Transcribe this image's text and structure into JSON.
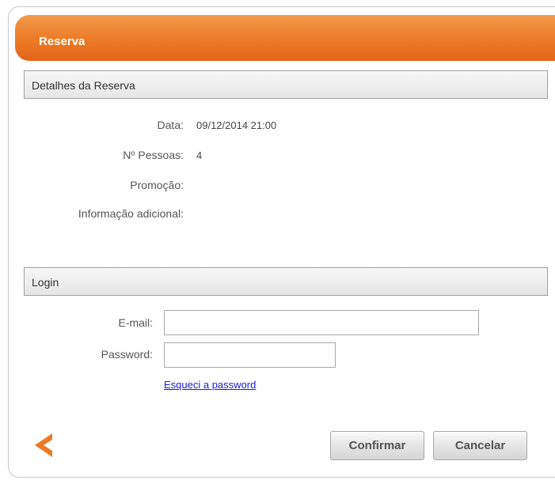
{
  "header": {
    "title": "Reserva"
  },
  "details": {
    "section_title": "Detalhes da Reserva",
    "date_label": "Data:",
    "date_value": "09/12/2014 21:00",
    "people_label": "Nº Pessoas:",
    "people_value": "4",
    "promo_label": "Promoção:",
    "promo_value": "",
    "info_label": "Informação adicional:",
    "info_value": ""
  },
  "login": {
    "section_title": "Login",
    "email_label": "E-mail:",
    "email_value": "",
    "password_label": "Password:",
    "password_value": "",
    "forgot_link": "Esqueci a password"
  },
  "actions": {
    "back_icon": "chevron-left-icon",
    "confirm_label": "Confirmar",
    "cancel_label": "Cancelar",
    "accent_color": "#ec7a26"
  }
}
